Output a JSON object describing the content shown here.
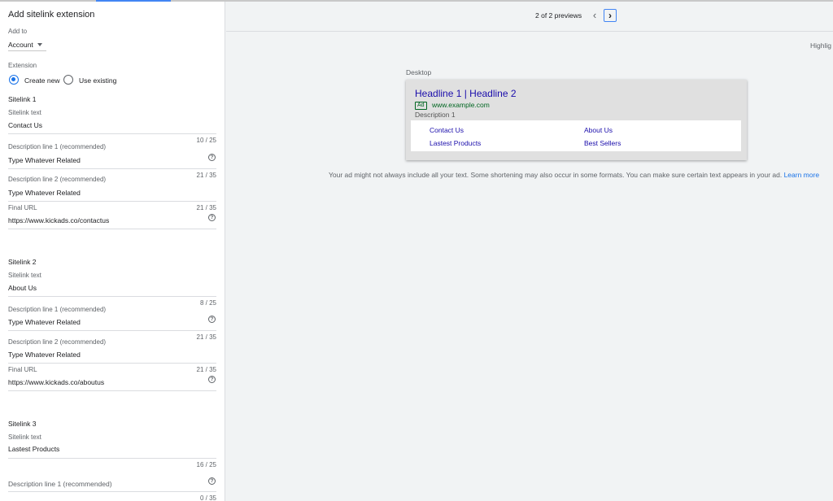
{
  "panel": {
    "title": "Add sitelink extension",
    "add_to_label": "Add to",
    "add_to_value": "Account",
    "extension_label": "Extension",
    "create_new": "Create new",
    "use_existing": "Use existing",
    "sitelink_text_label": "Sitelink text",
    "desc1_label": "Description line 1 (recommended)",
    "desc2_label": "Description line 2 (recommended)",
    "final_url_label": "Final URL",
    "sitelinks": [
      {
        "title": "Sitelink 1",
        "text": "Contact Us",
        "text_count": "10 / 25",
        "desc1": "Type Whatever Related",
        "desc1_count": "21 / 35",
        "desc2": "Type Whatever Related",
        "desc2_count": "21 / 35",
        "url": "https://www.kickads.co/contactus"
      },
      {
        "title": "Sitelink 2",
        "text": "About Us",
        "text_count": "8 / 25",
        "desc1": "Type Whatever Related",
        "desc1_count": "21 / 35",
        "desc2": "Type Whatever Related",
        "desc2_count": "21 / 35",
        "url": "https://www.kickads.co/aboutus"
      },
      {
        "title": "Sitelink 3",
        "text": "Lastest Products",
        "text_count": "16 / 25",
        "desc1_count": "0 / 35"
      }
    ]
  },
  "preview": {
    "pager_text": "2 of 2 previews",
    "highlight_label": "Highlig",
    "device_label": "Desktop",
    "ad": {
      "headline": "Headline 1 | Headline 2",
      "badge": "Ad",
      "display_url": "www.example.com",
      "description": "Description 1",
      "sitelinks": [
        "Contact Us",
        "About Us",
        "Lastest Products",
        "Best Sellers"
      ]
    },
    "note": "Your ad might not always include all your text. Some shortening may also occur in some formats. You can make sure certain text appears in your ad.",
    "learn_more": "Learn more"
  },
  "colors": {
    "accent": "#1a73e8",
    "ad_link": "#1a0dab",
    "ad_url": "#006621"
  }
}
